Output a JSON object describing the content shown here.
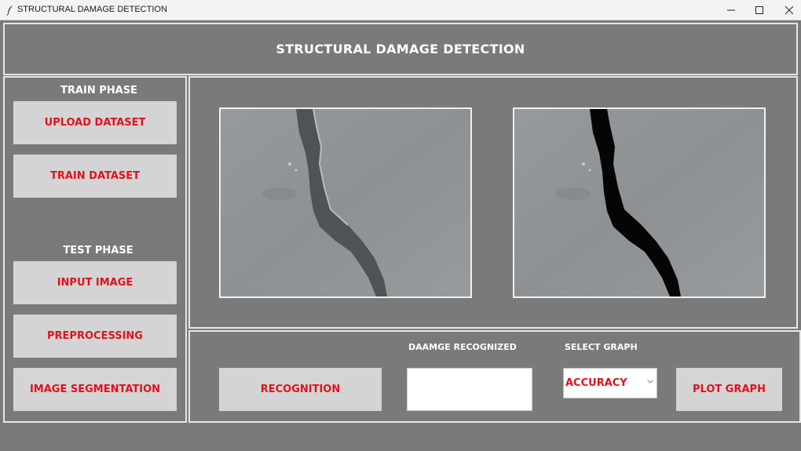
{
  "window": {
    "title": "STRUCTURAL DAMAGE DETECTION"
  },
  "header": {
    "title": "STRUCTURAL DAMAGE DETECTION"
  },
  "train_phase": {
    "label": "TRAIN PHASE",
    "upload_label": "UPLOAD DATASET",
    "train_label": "TRAIN DATASET"
  },
  "test_phase": {
    "label": "TEST PHASE",
    "input_label": "INPUT IMAGE",
    "preprocess_label": "PREPROCESSING",
    "segmentation_label": "IMAGE SEGMENTATION"
  },
  "bottom": {
    "recognition_label": "RECOGNITION",
    "damage_label": "DAAMGE RECOGNIZED",
    "damage_value": "",
    "select_graph_label": "SELECT  GRAPH",
    "graph_selected": "ACCURACY",
    "plot_label": "PLOT GRAPH"
  },
  "colors": {
    "background": "#7a7a7a",
    "button": "#d4d4d4",
    "button_text": "#e0121c",
    "border": "#e6e6e6"
  },
  "icons": [
    "feather-icon",
    "minimize-icon",
    "maximize-icon",
    "close-icon",
    "chevron-down-icon"
  ]
}
